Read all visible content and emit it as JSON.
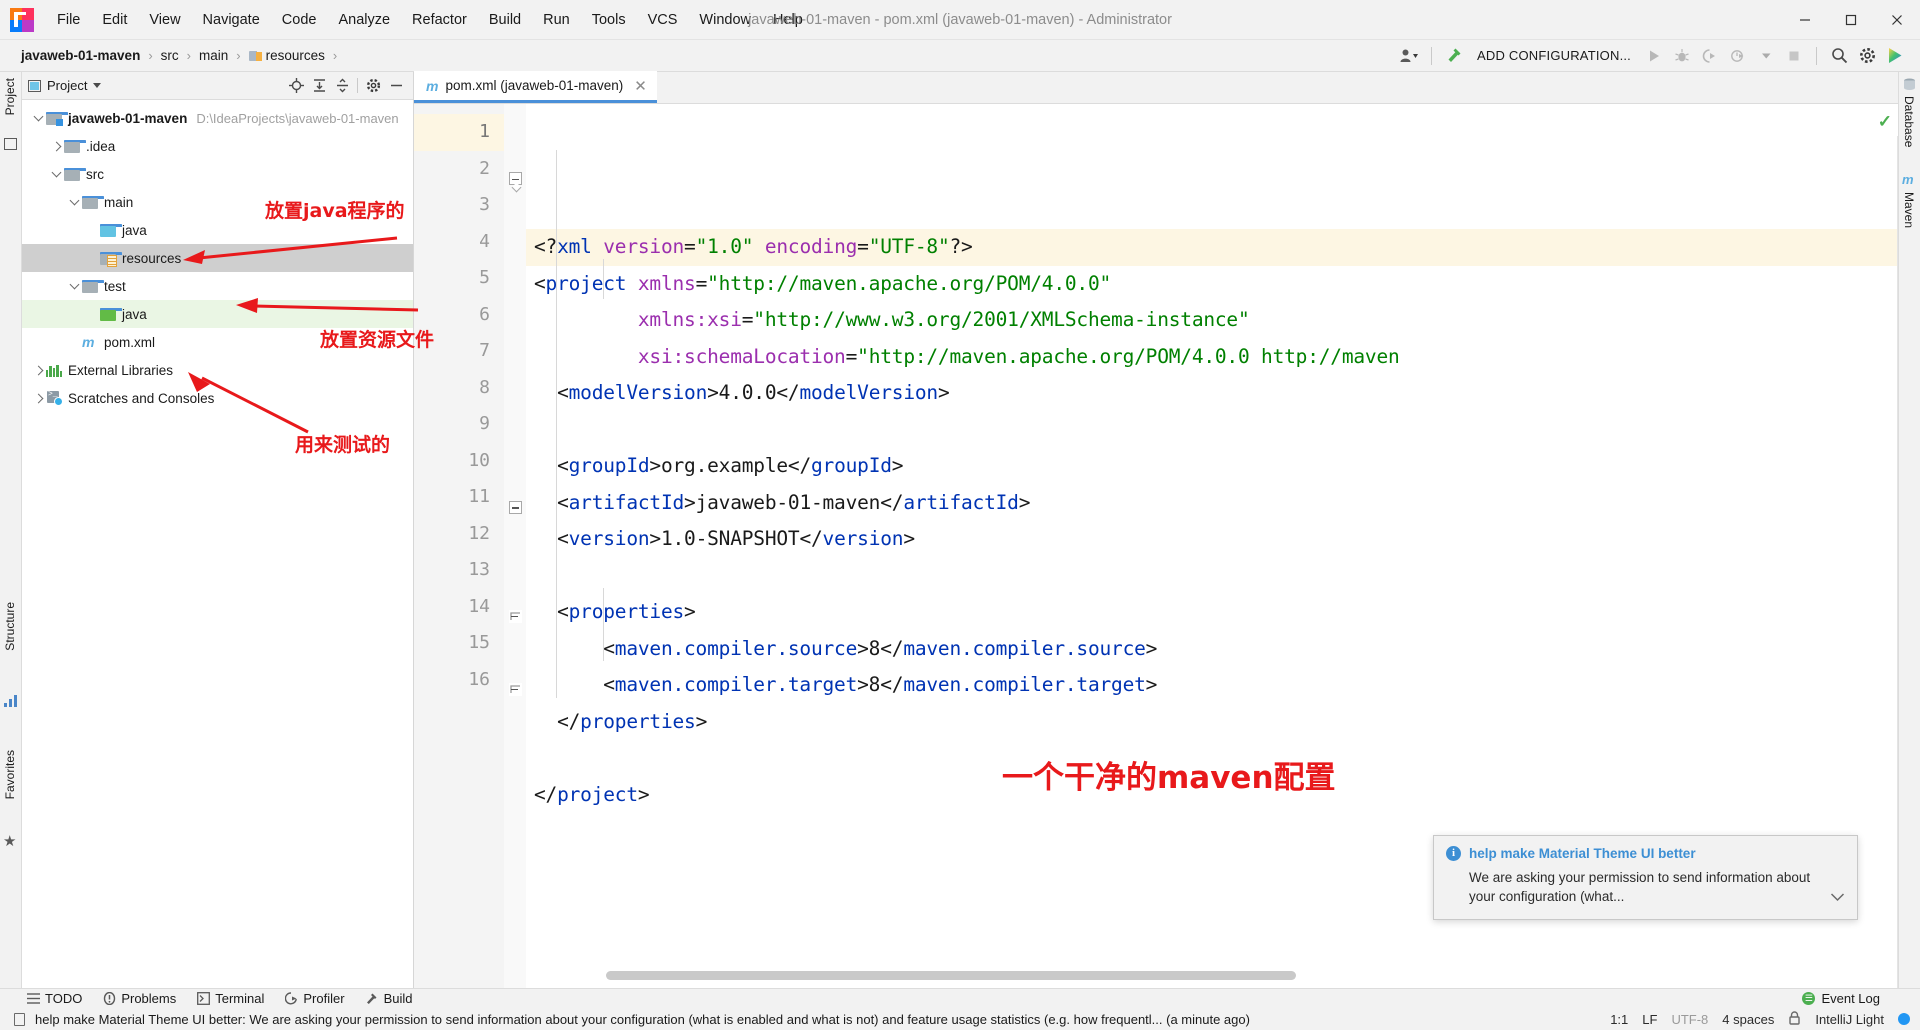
{
  "window": {
    "title": "javaweb-01-maven - pom.xml (javaweb-01-maven) - Administrator",
    "minimize": "─",
    "maximize": "☐",
    "close": "✕"
  },
  "menubar": {
    "items": [
      "File",
      "Edit",
      "View",
      "Navigate",
      "Code",
      "Analyze",
      "Refactor",
      "Build",
      "Run",
      "Tools",
      "VCS",
      "Window",
      "Help"
    ]
  },
  "navbar": {
    "breadcrumb": [
      "javaweb-01-maven",
      "src",
      "main",
      "resources"
    ],
    "separator": "›",
    "add_configuration": "ADD CONFIGURATION...",
    "icons": [
      "user-dropdown-icon",
      "build-hammer-icon",
      "run-icon",
      "debug-icon",
      "run-coverage-icon",
      "profiler-icon",
      "stop-icon",
      "search-everywhere-icon",
      "settings-gear-icon",
      "material-theme-icon"
    ]
  },
  "left_stripe": {
    "project_label": "Project",
    "structure_label": "Structure",
    "favorites_label": "Favorites"
  },
  "right_stripe": {
    "database_label": "Database",
    "maven_label": "Maven"
  },
  "project_panel": {
    "title": "Project",
    "actions": [
      "locate-icon",
      "expand-all-icon",
      "collapse-all-icon",
      "settings-gear-icon",
      "hide-icon"
    ],
    "tree": [
      {
        "label": "javaweb-01-maven",
        "path": "D:\\IdeaProjects\\javaweb-01-maven",
        "indent": 0,
        "twisty": "down",
        "icon": "project-folder-icon",
        "bold": true,
        "state": "normal"
      },
      {
        "label": ".idea",
        "path": "",
        "indent": 1,
        "twisty": "right",
        "icon": "folder-grey-icon",
        "bold": false,
        "state": "normal"
      },
      {
        "label": "src",
        "path": "",
        "indent": 1,
        "twisty": "down",
        "icon": "folder-grey-icon",
        "bold": false,
        "state": "normal"
      },
      {
        "label": "main",
        "path": "",
        "indent": 2,
        "twisty": "down",
        "icon": "folder-grey-icon",
        "bold": false,
        "state": "normal"
      },
      {
        "label": "java",
        "path": "",
        "indent": 3,
        "twisty": "none",
        "icon": "folder-sources-blue-icon",
        "bold": false,
        "state": "normal"
      },
      {
        "label": "resources",
        "path": "",
        "indent": 3,
        "twisty": "none",
        "icon": "folder-resources-icon",
        "bold": false,
        "state": "selected"
      },
      {
        "label": "test",
        "path": "",
        "indent": 2,
        "twisty": "down",
        "icon": "folder-grey-icon",
        "bold": false,
        "state": "normal"
      },
      {
        "label": "java",
        "path": "",
        "indent": 3,
        "twisty": "none",
        "icon": "folder-test-green-icon",
        "bold": false,
        "state": "green"
      },
      {
        "label": "pom.xml",
        "path": "",
        "indent": 2,
        "twisty": "none",
        "icon": "maven-m-icon",
        "bold": false,
        "state": "normal"
      },
      {
        "label": "External Libraries",
        "path": "",
        "indent": 0,
        "twisty": "right",
        "icon": "libraries-icon",
        "bold": false,
        "state": "normal"
      },
      {
        "label": "Scratches and Consoles",
        "path": "",
        "indent": 0,
        "twisty": "right",
        "icon": "scratches-icon",
        "bold": false,
        "state": "normal"
      }
    ]
  },
  "editor": {
    "tab": {
      "label": "pom.xml (javaweb-01-maven)",
      "icon": "maven-m-icon",
      "close": "✕"
    },
    "line_numbers": [
      1,
      2,
      3,
      4,
      5,
      6,
      7,
      8,
      9,
      10,
      11,
      12,
      13,
      14,
      15,
      16
    ],
    "current_line": 1,
    "code_lines": [
      {
        "n": 1,
        "tokens": [
          {
            "t": "<?",
            "c": "punct"
          },
          {
            "t": "xml",
            "c": "tagn"
          },
          {
            "t": " ",
            "c": "txt"
          },
          {
            "t": "version",
            "c": "attr"
          },
          {
            "t": "=",
            "c": "punct"
          },
          {
            "t": "\"1.0\"",
            "c": "strv"
          },
          {
            "t": " ",
            "c": "txt"
          },
          {
            "t": "encoding",
            "c": "attr"
          },
          {
            "t": "=",
            "c": "punct"
          },
          {
            "t": "\"UTF-8\"",
            "c": "strv"
          },
          {
            "t": "?>",
            "c": "punct"
          }
        ]
      },
      {
        "n": 2,
        "tokens": [
          {
            "t": "<",
            "c": "punct"
          },
          {
            "t": "project",
            "c": "tagn"
          },
          {
            "t": " ",
            "c": "txt"
          },
          {
            "t": "xmlns",
            "c": "attr"
          },
          {
            "t": "=",
            "c": "punct"
          },
          {
            "t": "\"http://maven.apache.org/POM/4.0.0\"",
            "c": "strv"
          }
        ]
      },
      {
        "n": 3,
        "tokens": [
          {
            "t": "         ",
            "c": "txt"
          },
          {
            "t": "xmlns:xsi",
            "c": "attr"
          },
          {
            "t": "=",
            "c": "punct"
          },
          {
            "t": "\"http://www.w3.org/2001/XMLSchema-instance\"",
            "c": "strv"
          }
        ]
      },
      {
        "n": 4,
        "tokens": [
          {
            "t": "         ",
            "c": "txt"
          },
          {
            "t": "xsi:schemaLocation",
            "c": "attr"
          },
          {
            "t": "=",
            "c": "punct"
          },
          {
            "t": "\"http://maven.apache.org/POM/4.0.0 http://maven",
            "c": "strv"
          }
        ]
      },
      {
        "n": 5,
        "tokens": [
          {
            "t": "  <",
            "c": "punct"
          },
          {
            "t": "modelVersion",
            "c": "tagn"
          },
          {
            "t": ">",
            "c": "punct"
          },
          {
            "t": "4.0.0",
            "c": "txt"
          },
          {
            "t": "</",
            "c": "punct"
          },
          {
            "t": "modelVersion",
            "c": "tagn"
          },
          {
            "t": ">",
            "c": "punct"
          }
        ]
      },
      {
        "n": 6,
        "tokens": []
      },
      {
        "n": 7,
        "tokens": [
          {
            "t": "  <",
            "c": "punct"
          },
          {
            "t": "groupId",
            "c": "tagn"
          },
          {
            "t": ">",
            "c": "punct"
          },
          {
            "t": "org.example",
            "c": "txt"
          },
          {
            "t": "</",
            "c": "punct"
          },
          {
            "t": "groupId",
            "c": "tagn"
          },
          {
            "t": ">",
            "c": "punct"
          }
        ]
      },
      {
        "n": 8,
        "tokens": [
          {
            "t": "  <",
            "c": "punct"
          },
          {
            "t": "artifactId",
            "c": "tagn"
          },
          {
            "t": ">",
            "c": "punct"
          },
          {
            "t": "javaweb-01-maven",
            "c": "txt"
          },
          {
            "t": "</",
            "c": "punct"
          },
          {
            "t": "artifactId",
            "c": "tagn"
          },
          {
            "t": ">",
            "c": "punct"
          }
        ]
      },
      {
        "n": 9,
        "tokens": [
          {
            "t": "  <",
            "c": "punct"
          },
          {
            "t": "version",
            "c": "tagn"
          },
          {
            "t": ">",
            "c": "punct"
          },
          {
            "t": "1.0-SNAPSHOT",
            "c": "txt"
          },
          {
            "t": "</",
            "c": "punct"
          },
          {
            "t": "version",
            "c": "tagn"
          },
          {
            "t": ">",
            "c": "punct"
          }
        ]
      },
      {
        "n": 10,
        "tokens": []
      },
      {
        "n": 11,
        "tokens": [
          {
            "t": "  <",
            "c": "punct"
          },
          {
            "t": "properties",
            "c": "tagn"
          },
          {
            "t": ">",
            "c": "punct"
          }
        ]
      },
      {
        "n": 12,
        "tokens": [
          {
            "t": "      <",
            "c": "punct"
          },
          {
            "t": "maven.compiler.source",
            "c": "tagn"
          },
          {
            "t": ">",
            "c": "punct"
          },
          {
            "t": "8",
            "c": "txt"
          },
          {
            "t": "</",
            "c": "punct"
          },
          {
            "t": "maven.compiler.source",
            "c": "tagn"
          },
          {
            "t": ">",
            "c": "punct"
          }
        ]
      },
      {
        "n": 13,
        "tokens": [
          {
            "t": "      <",
            "c": "punct"
          },
          {
            "t": "maven.compiler.target",
            "c": "tagn"
          },
          {
            "t": ">",
            "c": "punct"
          },
          {
            "t": "8",
            "c": "txt"
          },
          {
            "t": "</",
            "c": "punct"
          },
          {
            "t": "maven.compiler.target",
            "c": "tagn"
          },
          {
            "t": ">",
            "c": "punct"
          }
        ]
      },
      {
        "n": 14,
        "tokens": [
          {
            "t": "  </",
            "c": "punct"
          },
          {
            "t": "properties",
            "c": "tagn"
          },
          {
            "t": ">",
            "c": "punct"
          }
        ]
      },
      {
        "n": 15,
        "tokens": []
      },
      {
        "n": 16,
        "tokens": [
          {
            "t": "</",
            "c": "punct"
          },
          {
            "t": "project",
            "c": "tagn"
          },
          {
            "t": ">",
            "c": "punct"
          }
        ]
      }
    ]
  },
  "annotations": [
    {
      "id": "anno-java-main",
      "text": "放置java程序的"
    },
    {
      "id": "anno-resources",
      "text": "放置资源文件"
    },
    {
      "id": "anno-test",
      "text": "用来测试的"
    },
    {
      "id": "anno-clean-maven",
      "text": "一个干净的maven配置"
    }
  ],
  "balloon": {
    "title": "help make Material Theme UI better",
    "body": "We are asking your permission to send information about your configuration (what...",
    "collapse_icon": "chevron-down-icon"
  },
  "bottom_bar": {
    "items": [
      {
        "label": "TODO",
        "icon": "todo-icon"
      },
      {
        "label": "Problems",
        "icon": "problems-icon"
      },
      {
        "label": "Terminal",
        "icon": "terminal-icon"
      },
      {
        "label": "Profiler",
        "icon": "profiler-icon"
      },
      {
        "label": "Build",
        "icon": "build-hammer-icon"
      }
    ]
  },
  "status_bar": {
    "message": "help make Material Theme UI better: We are asking your permission to send information about your configuration (what is enabled and what is not) and feature usage statistics (e.g. how frequentl... (a minute ago)",
    "caret": "1:1",
    "line_separator": "LF",
    "encoding": "UTF-8",
    "indent": "4 spaces",
    "theme": "IntelliJ Light",
    "event_log": "Event Log",
    "lock_icon": "lock-icon"
  },
  "colors": {
    "accent_blue": "#4a90d9",
    "tag_blue": "#0033b3",
    "attr_purple": "#9b2fae",
    "string_green": "#008000",
    "annotation_red": "#e8191b",
    "selected_grey": "#cfcfcf",
    "test_green_bg": "#eaf6e4"
  }
}
